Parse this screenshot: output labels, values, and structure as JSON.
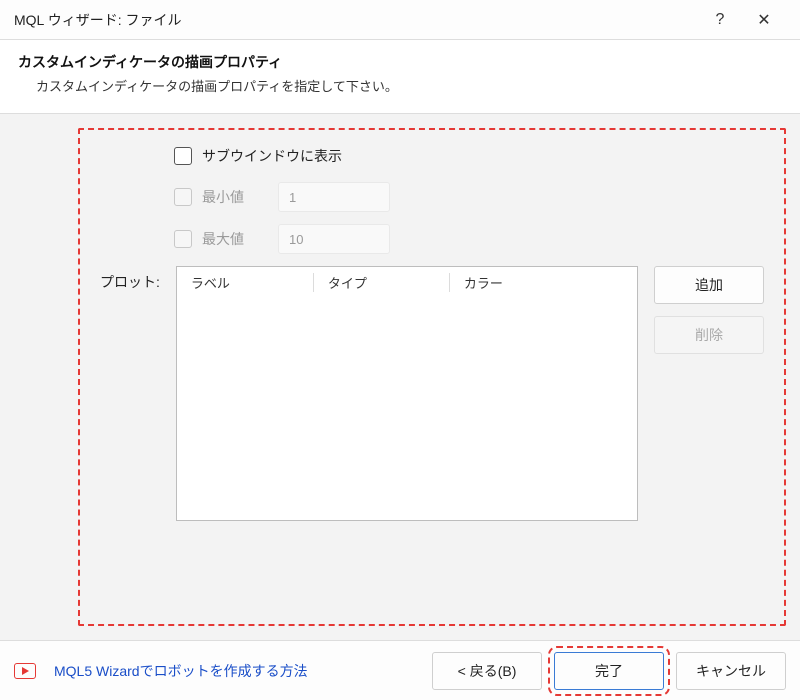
{
  "titlebar": {
    "title": "MQL ウィザード: ファイル",
    "help_glyph": "?",
    "close_glyph": "✕"
  },
  "header": {
    "title": "カスタムインディケータの描画プロパティ",
    "subtitle": "カスタムインディケータの描画プロパティを指定して下さい。"
  },
  "options": {
    "show_in_subwindow": {
      "label": "サブウインドウに表示",
      "checked": false
    },
    "min": {
      "label": "最小値",
      "value": "1",
      "checked": false,
      "disabled": true
    },
    "max": {
      "label": "最大値",
      "value": "10",
      "checked": false,
      "disabled": true
    }
  },
  "plot": {
    "label": "プロット:",
    "columns": {
      "label": "ラベル",
      "type": "タイプ",
      "color": "カラー"
    },
    "rows": []
  },
  "side": {
    "add": "追加",
    "remove": "削除"
  },
  "footer": {
    "link": "MQL5 Wizardでロボットを作成する方法",
    "back": "< 戻る(B)",
    "finish": "完了",
    "cancel": "キャンセル"
  }
}
